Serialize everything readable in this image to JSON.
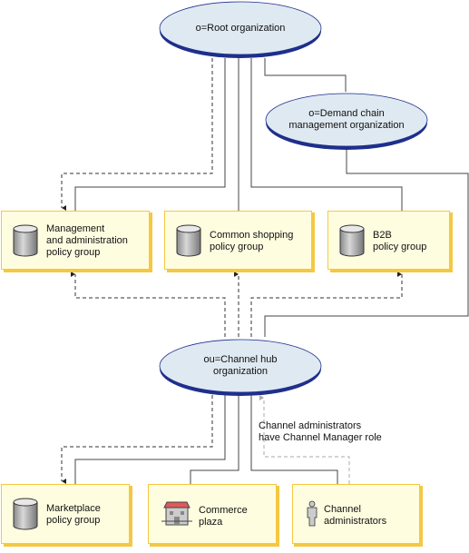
{
  "nodes": {
    "root": {
      "label": [
        "o=Root organization"
      ]
    },
    "demand": {
      "label": [
        "o=Demand chain",
        "management organization"
      ]
    },
    "hub": {
      "label": [
        "ou=Channel hub",
        "organization"
      ]
    },
    "mgmt": {
      "label": [
        "Management",
        "and administration",
        "policy group"
      ],
      "icon": "database-icon"
    },
    "common": {
      "label": [
        "Common shopping",
        "policy group"
      ],
      "icon": "database-icon"
    },
    "b2b": {
      "label": [
        "B2B",
        "policy group"
      ],
      "icon": "database-icon"
    },
    "market": {
      "label": [
        "Marketplace",
        "policy group"
      ],
      "icon": "database-icon"
    },
    "plaza": {
      "label": [
        "Commerce",
        "plaza"
      ],
      "icon": "store-icon"
    },
    "admins": {
      "label": [
        "Channel",
        "administrators"
      ],
      "icon": "person-icon"
    }
  },
  "annotation": [
    "Channel administrators",
    "have Channel Manager role"
  ],
  "colors": {
    "ellipse_fill": "#dfe9f1",
    "ellipse_edge": "#1e2f8c",
    "box_fill": "#fffde0",
    "box_border": "#f5c842",
    "line": "#444444",
    "dashed_gray": "#aaaaaa"
  }
}
